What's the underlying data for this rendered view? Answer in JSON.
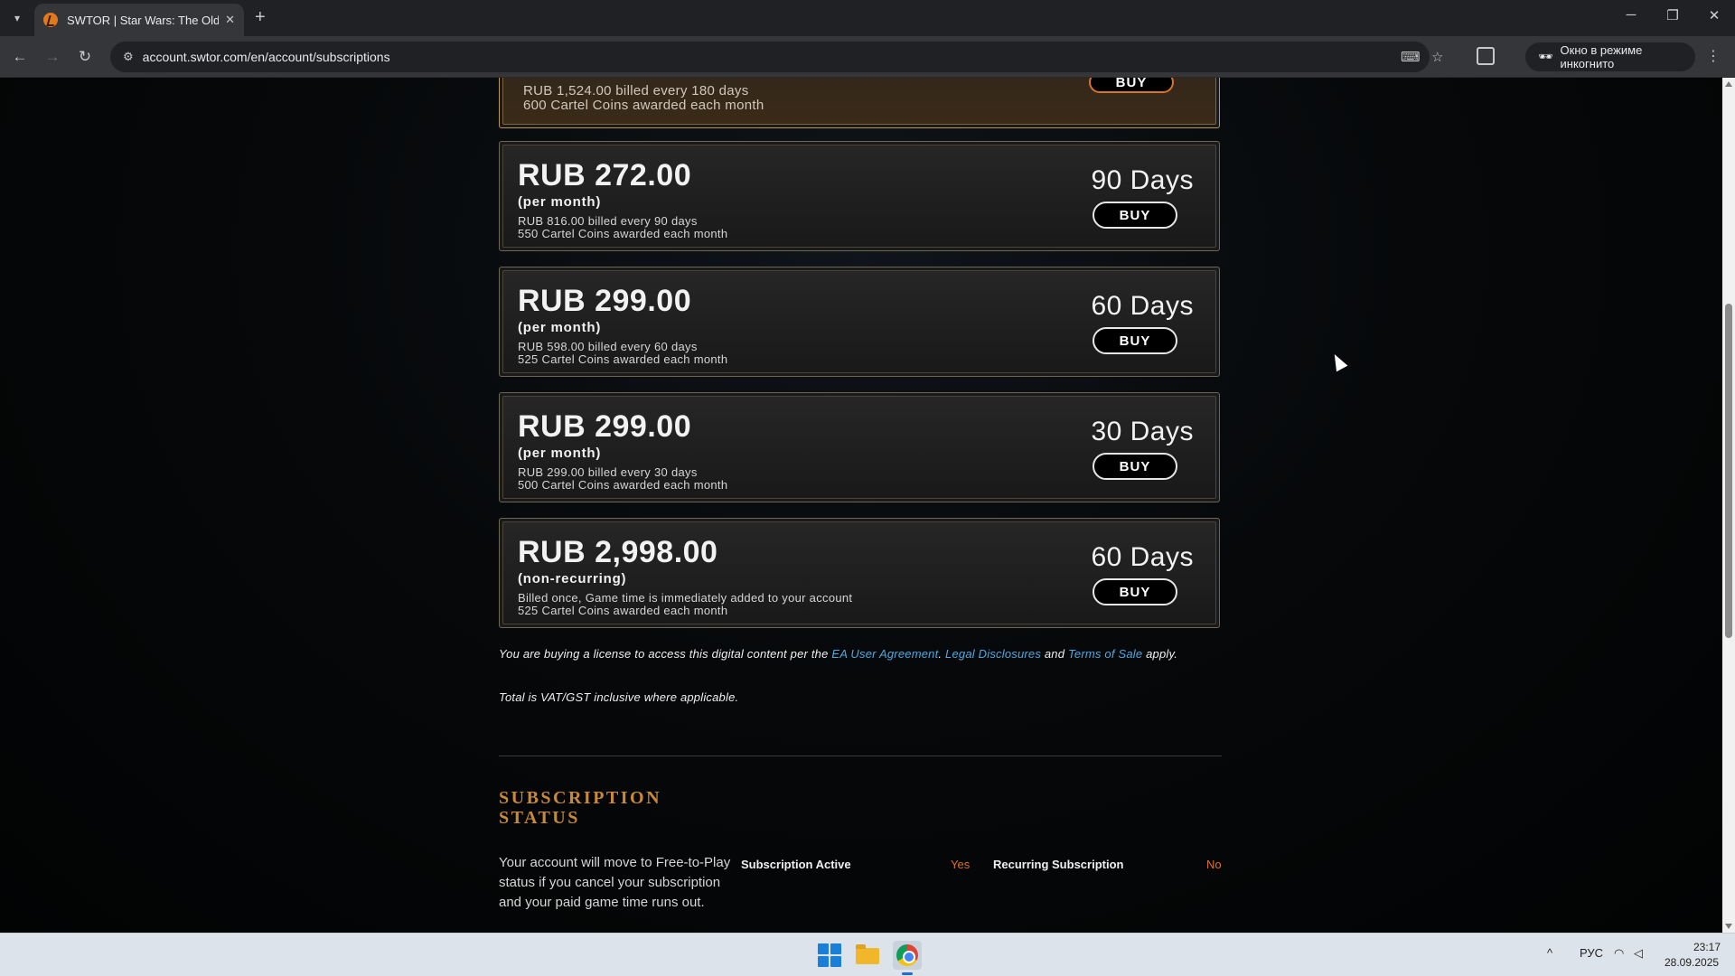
{
  "browser": {
    "tab_title": "SWTOR | Star Wars: The Old Rep",
    "url": "account.swtor.com/en/account/subscriptions",
    "incognito_label": "Окно в режиме инкогнито"
  },
  "partial_plan": {
    "billed": "RUB 1,524.00 billed every 180 days",
    "coins": "600 Cartel Coins awarded each month",
    "buy": "BUY"
  },
  "plans": [
    {
      "price": "RUB 272.00",
      "period": "(per month)",
      "billed": "RUB 816.00 billed every 90 days",
      "coins": "550 Cartel Coins awarded each month",
      "days": "90 Days",
      "buy": "BUY"
    },
    {
      "price": "RUB 299.00",
      "period": "(per month)",
      "billed": "RUB 598.00 billed every 60 days",
      "coins": "525 Cartel Coins awarded each month",
      "days": "60 Days",
      "buy": "BUY"
    },
    {
      "price": "RUB 299.00",
      "period": "(per month)",
      "billed": "RUB 299.00 billed every 30 days",
      "coins": "500 Cartel Coins awarded each month",
      "days": "30 Days",
      "buy": "BUY"
    },
    {
      "price": "RUB 2,998.00",
      "period": "(non-recurring)",
      "billed": "Billed once, Game time is immediately added to your account",
      "coins": "525 Cartel Coins awarded each month",
      "days": "60 Days",
      "buy": "BUY"
    }
  ],
  "legal": {
    "prefix": "You are buying a license to access this digital content per the ",
    "link1": "EA User Agreement",
    "sep1": ". ",
    "link2": "Legal Disclosures",
    "sep2": " and ",
    "link3": "Terms of Sale",
    "suffix": " apply.",
    "vat": "Total is VAT/GST inclusive where applicable."
  },
  "subscription_status": {
    "title": "SUBSCRIPTION STATUS",
    "description": "Your account will move to Free-to-Play status if you cancel your subscription and your paid game time runs out.",
    "active_label": "Subscription Active",
    "active_value": "Yes",
    "recurring_label": "Recurring Subscription",
    "recurring_value": "No"
  },
  "taskbar": {
    "lang": "РУС",
    "time": "23:17",
    "date": "28.09.2025"
  },
  "colors": {
    "accent_gold": "#c8893a",
    "status_value": "#e0702a",
    "link": "#4fa8e0"
  }
}
